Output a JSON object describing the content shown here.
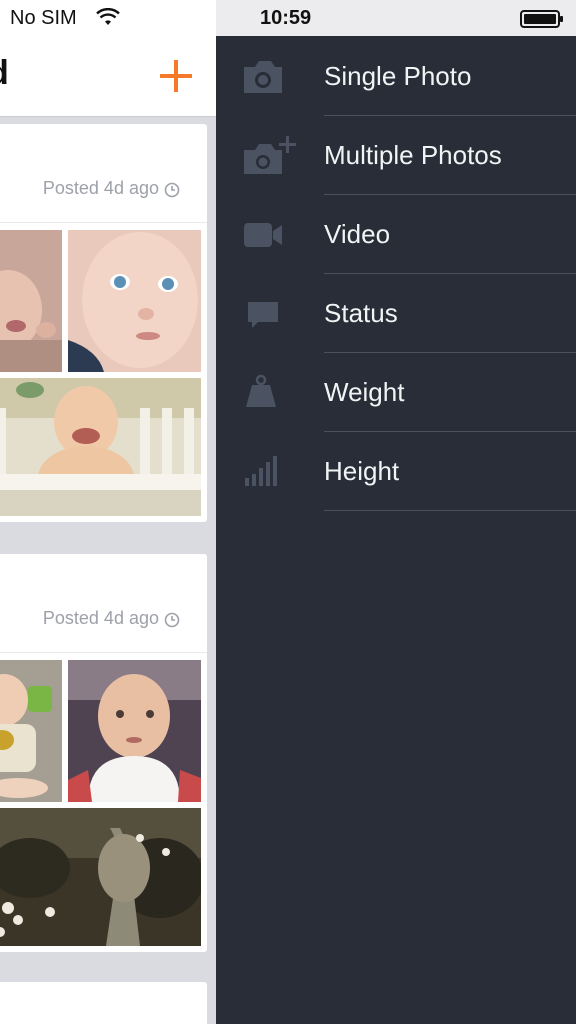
{
  "status_bar": {
    "carrier": "No SIM",
    "time": "10:59"
  },
  "feed": {
    "title_fragment": "d",
    "posts": [
      {
        "posted": "Posted 4d ago"
      },
      {
        "posted": "Posted 4d ago"
      }
    ]
  },
  "menu": {
    "items": [
      {
        "label": "Single Photo",
        "icon": "camera-icon"
      },
      {
        "label": "Multiple Photos",
        "icon": "camera-plus-icon"
      },
      {
        "label": "Video",
        "icon": "video-icon"
      },
      {
        "label": "Status",
        "icon": "speech-bubble-icon"
      },
      {
        "label": "Weight",
        "icon": "weight-icon"
      },
      {
        "label": "Height",
        "icon": "height-bars-icon"
      }
    ]
  },
  "colors": {
    "accent": "#f47a2a",
    "menu_bg": "#282d38",
    "menu_icon": "#4b5261",
    "menu_text": "#f2f3f5"
  }
}
